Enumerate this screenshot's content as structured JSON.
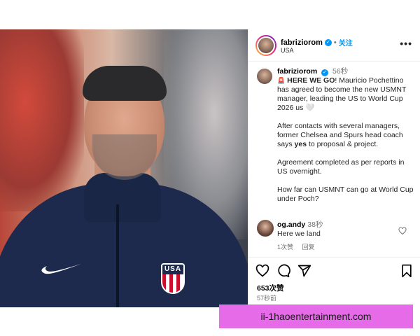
{
  "post": {
    "username": "fabriziorom",
    "follow_label": "关注",
    "location": "USA",
    "more_label": "•••"
  },
  "caption": {
    "username": "fabriziorom",
    "time": "56秒",
    "siren": "🚨",
    "headline": "HERE WE GO",
    "para1_rest": "! Mauricio Pochettino has agreed to become the new USMNT manager, leading the US to World Cup 2026 us 🤍",
    "para2_before": "After contacts with several managers, former Chelsea and Spurs head coach says ",
    "para2_bold": "yes",
    "para2_after": " to proposal & project.",
    "para3": "Agreement completed as per reports in US overnight.",
    "para4": "How far can USMNT can go at World Cup under Poch?"
  },
  "comment": {
    "username": "og.andy",
    "time": "38秒",
    "text": "Here we land",
    "likes_label": "1次赞",
    "reply_label": "回复"
  },
  "actions": {
    "likes": "653次赞",
    "posted": "57秒前"
  },
  "photo": {
    "crest_text": "USA"
  },
  "watermark": {
    "text": "ii-1haoentertainment.com"
  },
  "colors": {
    "link_blue": "#0095f6",
    "watermark_bg": "#e66be8",
    "jacket_navy": "#1d2a4e"
  }
}
